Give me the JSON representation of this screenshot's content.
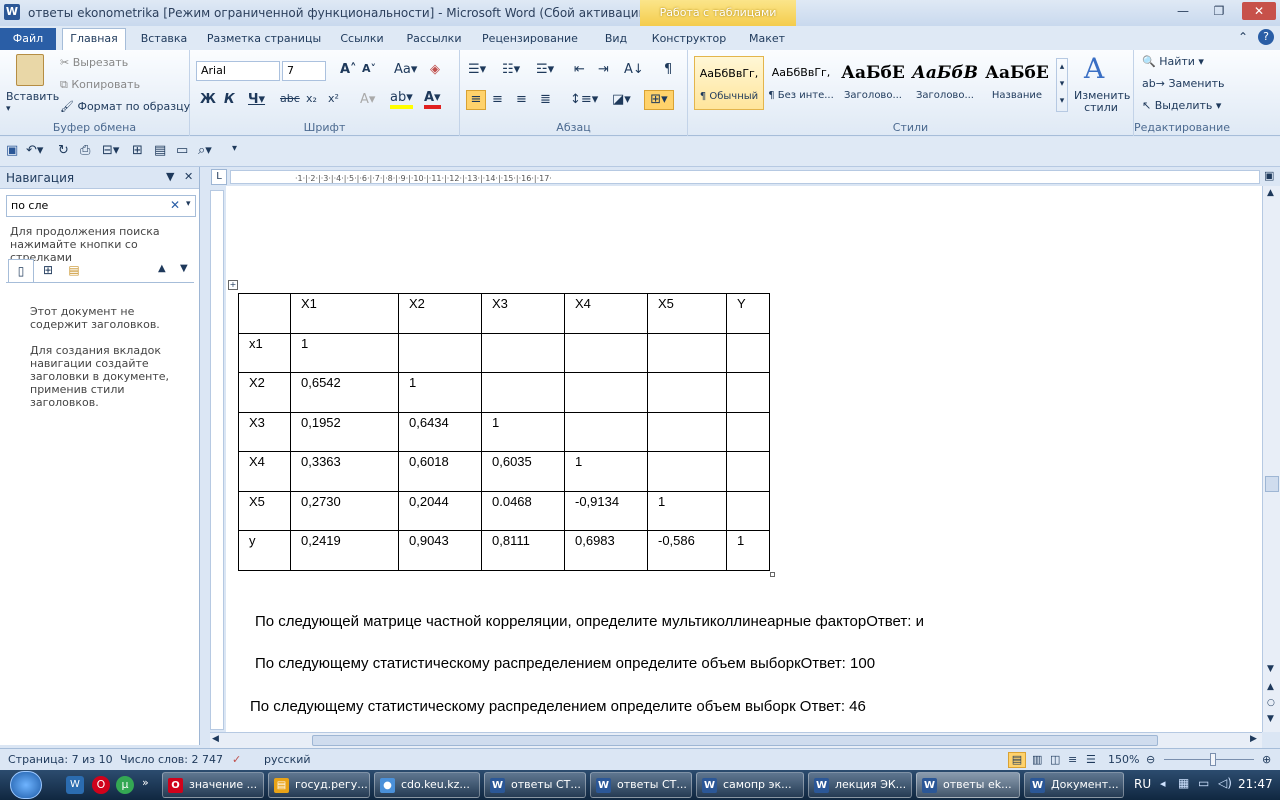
{
  "window": {
    "title": "ответы ekonometrika [Режим ограниченной функциональности]  -  Microsoft Word (Сбой активации проду...",
    "context_tab": "Работа с таблицами"
  },
  "tabs": [
    "Файл",
    "Главная",
    "Вставка",
    "Разметка страницы",
    "Ссылки",
    "Рассылки",
    "Рецензирование",
    "Вид",
    "Конструктор",
    "Макет"
  ],
  "clipboard": {
    "paste": "Вставить",
    "cut": "Вырезать",
    "copy": "Копировать",
    "format_painter": "Формат по образцу",
    "group": "Буфер обмена"
  },
  "font": {
    "name": "Arial",
    "size": "7",
    "group": "Шрифт"
  },
  "paragraph": {
    "group": "Абзац"
  },
  "styles": {
    "items": [
      {
        "preview": "АаБбВвГг,",
        "name": "¶ Обычный"
      },
      {
        "preview": "АаБбВвГг,",
        "name": "¶ Без инте..."
      },
      {
        "preview": "АаБбЕ",
        "name": "Заголово..."
      },
      {
        "preview": "АаБбВ",
        "name": "Заголово..."
      },
      {
        "preview": "АаБбЕ",
        "name": "Название"
      }
    ],
    "change": "Изменить стили",
    "group": "Стили"
  },
  "editing": {
    "find": "Найти",
    "replace": "Заменить",
    "select": "Выделить",
    "group": "Редактирование"
  },
  "nav": {
    "title": "Навигация",
    "search": "по сле",
    "hint": "Для продолжения поиска нажимайте кнопки со стрелками",
    "msg1": "Этот документ не содержит заголовков.",
    "msg2": "Для создания вкладок навигации создайте заголовки в документе, применив стили заголовков."
  },
  "table": {
    "headers": [
      "",
      "X1",
      "X2",
      "X3",
      "X4",
      "X5",
      "Y"
    ],
    "rows": [
      [
        "x1",
        "1",
        "",
        "",
        "",
        "",
        ""
      ],
      [
        "X2",
        "0,6542",
        "1",
        "",
        "",
        "",
        ""
      ],
      [
        "X3",
        "0,1952",
        "0,6434",
        "1",
        "",
        "",
        ""
      ],
      [
        "X4",
        "0,3363",
        "0,6018",
        "0,6035",
        "1",
        "",
        ""
      ],
      [
        "X5",
        "0,2730",
        "0,2044",
        "0.0468",
        "-0,9134",
        "1",
        ""
      ],
      [
        "y",
        "0,2419",
        "0,9043",
        "0,8111",
        "0,6983",
        "-0,586",
        "1"
      ]
    ]
  },
  "paragraphs": [
    "По следующей матрице частной корреляции, определите мультиколлинеарные факторОтвет:  и",
    "По следующему статистическому распределением определите объем выборкОтвет: 100",
    "По следующему статистическому распределением определите объем выборк Ответ: 46"
  ],
  "status": {
    "page": "Страница: 7 из 10",
    "words": "Число слов: 2 747",
    "lang": "русский",
    "zoom": "150%"
  },
  "taskbar": {
    "items": [
      {
        "label": "значение ...",
        "color": "#d0021b",
        "icon": "O"
      },
      {
        "label": "госуд.регу...",
        "color": "#e8a317",
        "icon": "▤"
      },
      {
        "label": "cdo.keu.kz...",
        "color": "#4a90d9",
        "icon": "●"
      },
      {
        "label": "ответы СТ...",
        "color": "#2b5797",
        "icon": "W"
      },
      {
        "label": "ответы СТ...",
        "color": "#2b5797",
        "icon": "W"
      },
      {
        "label": "самопр эк...",
        "color": "#2b5797",
        "icon": "W"
      },
      {
        "label": "лекция ЭК...",
        "color": "#2b5797",
        "icon": "W"
      },
      {
        "label": "ответы ek...",
        "color": "#2b5797",
        "icon": "W"
      },
      {
        "label": "Документ...",
        "color": "#2b5797",
        "icon": "W"
      }
    ],
    "lang": "RU",
    "clock": "21:47"
  }
}
